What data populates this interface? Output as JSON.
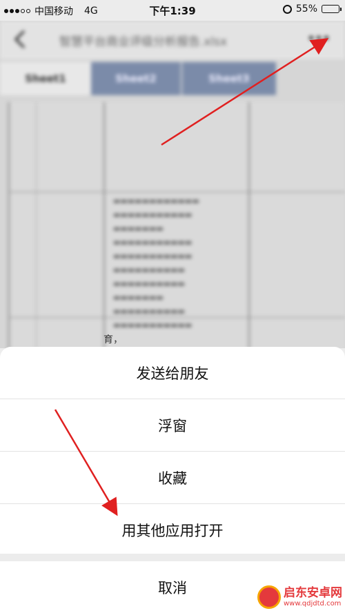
{
  "status_bar": {
    "carrier": "中国移动",
    "network": "4G",
    "time": "下午1:39",
    "battery": "55%",
    "battery_level": 0.55
  },
  "document": {
    "title_blurred": "智慧平台商业评级分析报告.xlsx",
    "tabs": [
      "Sheet1",
      "Sheet2",
      "Sheet3"
    ],
    "visible_cell_text": "育，"
  },
  "action_sheet": {
    "options": [
      "发送给朋友",
      "浮窗",
      "收藏",
      "用其他应用打开"
    ],
    "cancel": "取消"
  },
  "annotation": {
    "arrow_color": "#e02020"
  },
  "watermark": {
    "title": "启东安卓网",
    "url": "www.qdjdtd.com"
  }
}
